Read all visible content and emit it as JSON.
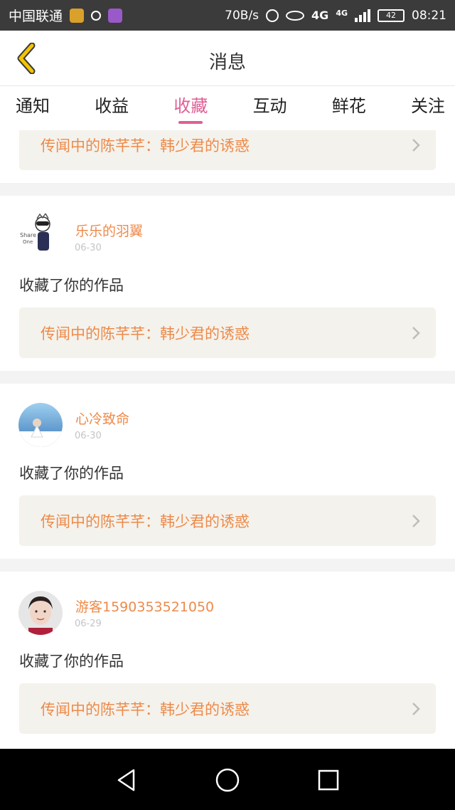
{
  "status_bar": {
    "carrier": "中国联通",
    "speed": "70B/s",
    "network": "4G",
    "network_small": "4G",
    "battery": "42",
    "time": "08:21"
  },
  "header": {
    "title": "消息",
    "back_icon": "chevron-left-icon"
  },
  "tabs": [
    {
      "label": "通知",
      "active": false
    },
    {
      "label": "收益",
      "active": false
    },
    {
      "label": "收藏",
      "active": true
    },
    {
      "label": "互动",
      "active": false
    },
    {
      "label": "鲜花",
      "active": false
    },
    {
      "label": "关注",
      "active": false
    }
  ],
  "items": [
    {
      "user": "",
      "date": "",
      "action": "",
      "work_title": "传闻中的陈芊芊：韩少君的诱惑"
    },
    {
      "user": "乐乐的羽翼",
      "date": "06-30",
      "action": "收藏了你的作品",
      "work_title": "传闻中的陈芊芊：韩少君的诱惑"
    },
    {
      "user": "心冷致命",
      "date": "06-30",
      "action": "收藏了你的作品",
      "work_title": "传闻中的陈芊芊：韩少君的诱惑"
    },
    {
      "user": "游客15903535​21050",
      "date": "06-29",
      "action": "收藏了你的作品",
      "work_title": "传闻中的陈芊芊：韩少君的诱惑"
    }
  ],
  "colors": {
    "accent": "#e05e95",
    "username": "#ed8a4a",
    "back_arrow": "#f5c400"
  },
  "nav": {
    "back": "triangle-back-icon",
    "home": "circle-home-icon",
    "recents": "square-recents-icon"
  }
}
